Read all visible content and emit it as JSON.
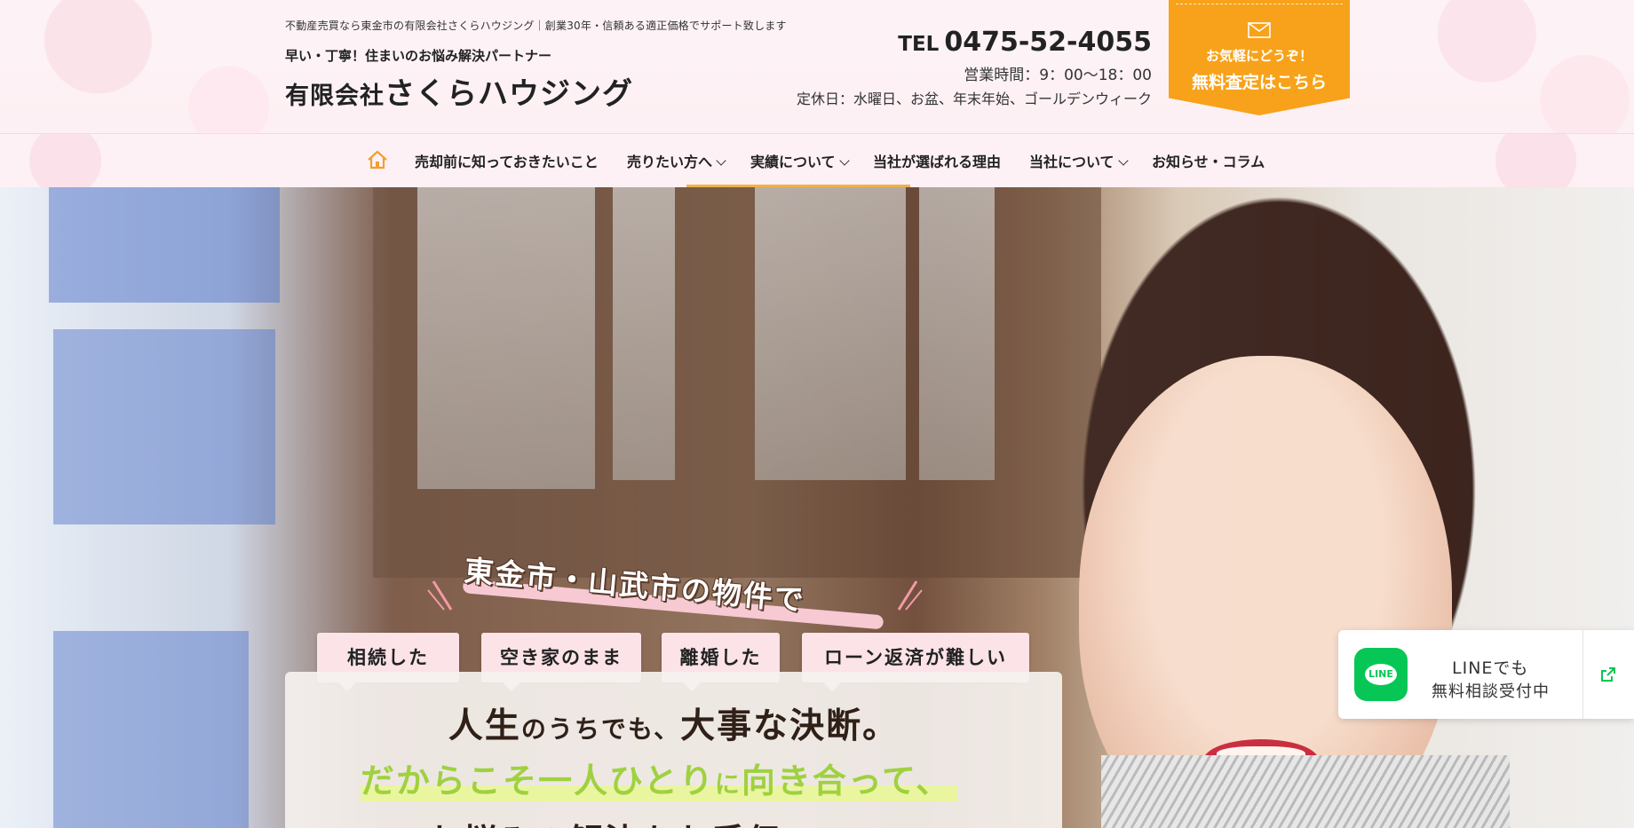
{
  "header": {
    "tagline": "不動産売買なら東金市の有限会社さくらハウジング｜創業30年・信頼ある適正価格でサポート致します",
    "subtitle": "早い・丁寧！住まいのお悩み解決パートナー",
    "company_prefix": "有限会社",
    "company_name": "さくらハウジング",
    "tel_label": "TEL",
    "tel_number": "0475-52-4055",
    "hours": "営業時間：9：00〜18：00",
    "closed_days": "定休日：水曜日、お盆、年末年始、ゴールデンウィーク",
    "cta_line1": "お気軽にどうぞ！",
    "cta_line2": "無料査定はこちら",
    "cta_color": "#f7a21a"
  },
  "nav": {
    "home_icon": "home-icon",
    "items": [
      {
        "label": "売却前に知っておきたいこと",
        "has_dropdown": false
      },
      {
        "label": "売りたい方へ",
        "has_dropdown": true
      },
      {
        "label": "実績について",
        "has_dropdown": true
      },
      {
        "label": "当社が選ばれる理由",
        "has_dropdown": false
      },
      {
        "label": "当社について",
        "has_dropdown": true
      },
      {
        "label": "お知らせ・コラム",
        "has_dropdown": false
      }
    ],
    "accent": "#f0b14a"
  },
  "hero": {
    "catch": "東金市・山武市の物件で",
    "tags": [
      "相続した",
      "空き家のまま",
      "離婚した",
      "ローン返済が難しい"
    ],
    "line1_a": "人生",
    "line1_b": "のうちでも、",
    "line1_c": "大事な決断。",
    "line2_a": "だからこそ一人ひとり",
    "line2_b": "に",
    "line2_c": "向き合って、",
    "line3": "お悩みの解決をお手伝い",
    "highlight_color": "#9fd13f"
  },
  "line_widget": {
    "logo_text": "LINE",
    "text1": "LINEでも",
    "text2": "無料相談受付中",
    "brand_color": "#06c755",
    "icon": "external-link-icon"
  }
}
